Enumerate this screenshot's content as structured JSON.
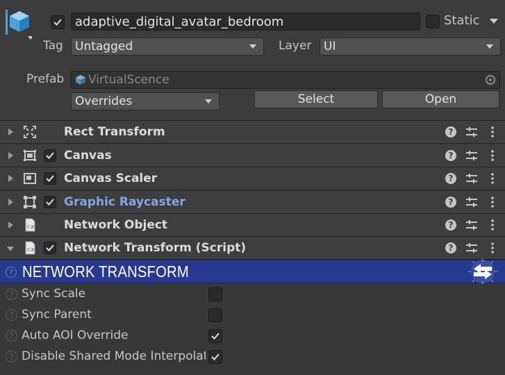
{
  "gameobject": {
    "name": "adaptive_digital_avatar_bedroom",
    "active": true,
    "static_label": "Static",
    "static_checked": false,
    "tag_label": "Tag",
    "tag_value": "Untagged",
    "layer_label": "Layer",
    "layer_value": "UI"
  },
  "prefab": {
    "label": "Prefab",
    "asset": "VirtualScence",
    "overrides_label": "Overrides",
    "select_label": "Select",
    "open_label": "Open"
  },
  "components": [
    {
      "name": "Rect Transform",
      "icon": "rect-transform-icon",
      "has_checkbox": false,
      "expanded": false
    },
    {
      "name": "Canvas",
      "icon": "canvas-icon",
      "has_checkbox": true,
      "expanded": false
    },
    {
      "name": "Canvas Scaler",
      "icon": "canvas-scaler-icon",
      "has_checkbox": true,
      "expanded": false
    },
    {
      "name": "Graphic Raycaster",
      "icon": "graphic-raycaster-icon",
      "has_checkbox": true,
      "expanded": false
    },
    {
      "name": "Network Object",
      "icon": "script-icon",
      "has_checkbox": false,
      "expanded": false
    },
    {
      "name": "Network Transform (Script)",
      "icon": "script-icon",
      "has_checkbox": true,
      "expanded": true
    }
  ],
  "banner": {
    "title": "NETWORK TRANSFORM",
    "color": "#27398e"
  },
  "properties": [
    {
      "label": "Sync Scale",
      "checked": false
    },
    {
      "label": "Sync Parent",
      "checked": false
    },
    {
      "label": "Auto AOI Override",
      "checked": true
    },
    {
      "label": "Disable Shared Mode Interpolation",
      "checked": true
    }
  ],
  "colors": {
    "background": "#383838",
    "link": "#82a8e6",
    "accent_icon": "#4aa3df"
  }
}
